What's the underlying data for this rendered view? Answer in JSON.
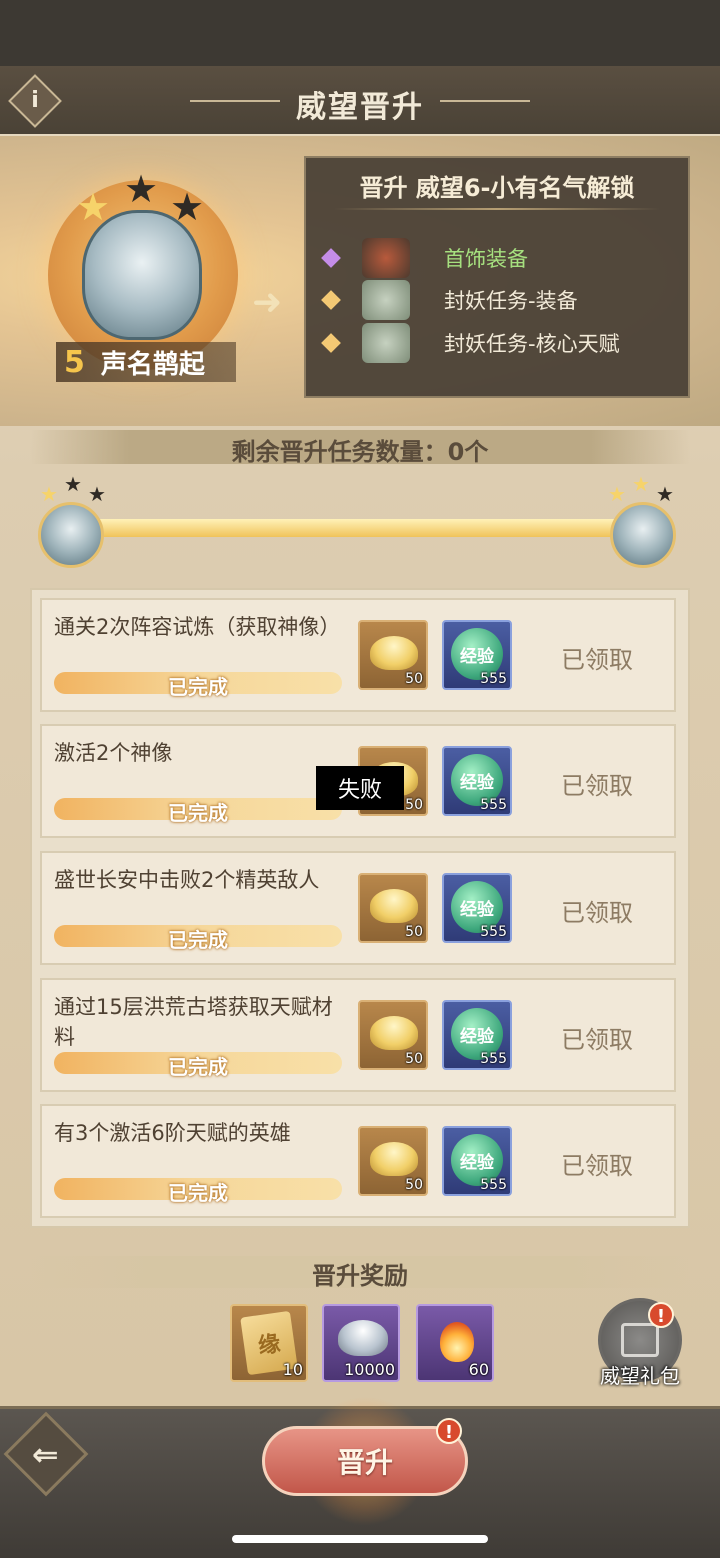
{
  "header": {
    "title": "威望晋升"
  },
  "badge": {
    "level": "5",
    "name": "声名鹊起",
    "stars_filled": 1,
    "stars_total": 3
  },
  "unlock": {
    "title": "晋升 威望6-小有名气解锁",
    "items": [
      {
        "label": "首饰装备",
        "color": "#a6e07f",
        "diamond_color": "#c58de8"
      },
      {
        "label": "封妖任务-装备",
        "color": "#f2ead8",
        "diamond_color": "#f4c974"
      },
      {
        "label": "封妖任务-核心天赋",
        "color": "#f2ead8",
        "diamond_color": "#f4c974"
      }
    ]
  },
  "remaining": {
    "label": "剩余晋升任务数量：0个"
  },
  "progress": {
    "fraction": 1.0
  },
  "tasks": [
    {
      "name": "通关2次阵容试炼（获取神像）",
      "progress_label": "已完成",
      "gold_count": "50",
      "exp_label": "经验",
      "exp_count": "555",
      "status": "已领取"
    },
    {
      "name": "激活2个神像",
      "progress_label": "已完成",
      "gold_count": "50",
      "exp_label": "经验",
      "exp_count": "555",
      "status": "已领取"
    },
    {
      "name": "盛世长安中击败2个精英敌人",
      "progress_label": "已完成",
      "gold_count": "50",
      "exp_label": "经验",
      "exp_count": "555",
      "status": "已领取"
    },
    {
      "name": "通过15层洪荒古塔获取天赋材料",
      "progress_label": "已完成",
      "gold_count": "50",
      "exp_label": "经验",
      "exp_count": "555",
      "status": "已领取"
    },
    {
      "name": "有3个激活6阶天赋的英雄",
      "progress_label": "已完成",
      "gold_count": "50",
      "exp_label": "经验",
      "exp_count": "555",
      "status": "已领取"
    }
  ],
  "toast": {
    "text": "失败"
  },
  "rewards": {
    "title": "晋升奖励",
    "items": [
      {
        "icon": "fate-scroll-icon",
        "glyph": "缘",
        "count": "10"
      },
      {
        "icon": "silver-ingot-icon",
        "count": "10000"
      },
      {
        "icon": "flame-icon",
        "count": "60"
      }
    ]
  },
  "gift": {
    "label": "威望礼包",
    "alert": "!"
  },
  "footer": {
    "back_glyph": "⇐",
    "promote_label": "晋升",
    "promote_alert": "!"
  }
}
